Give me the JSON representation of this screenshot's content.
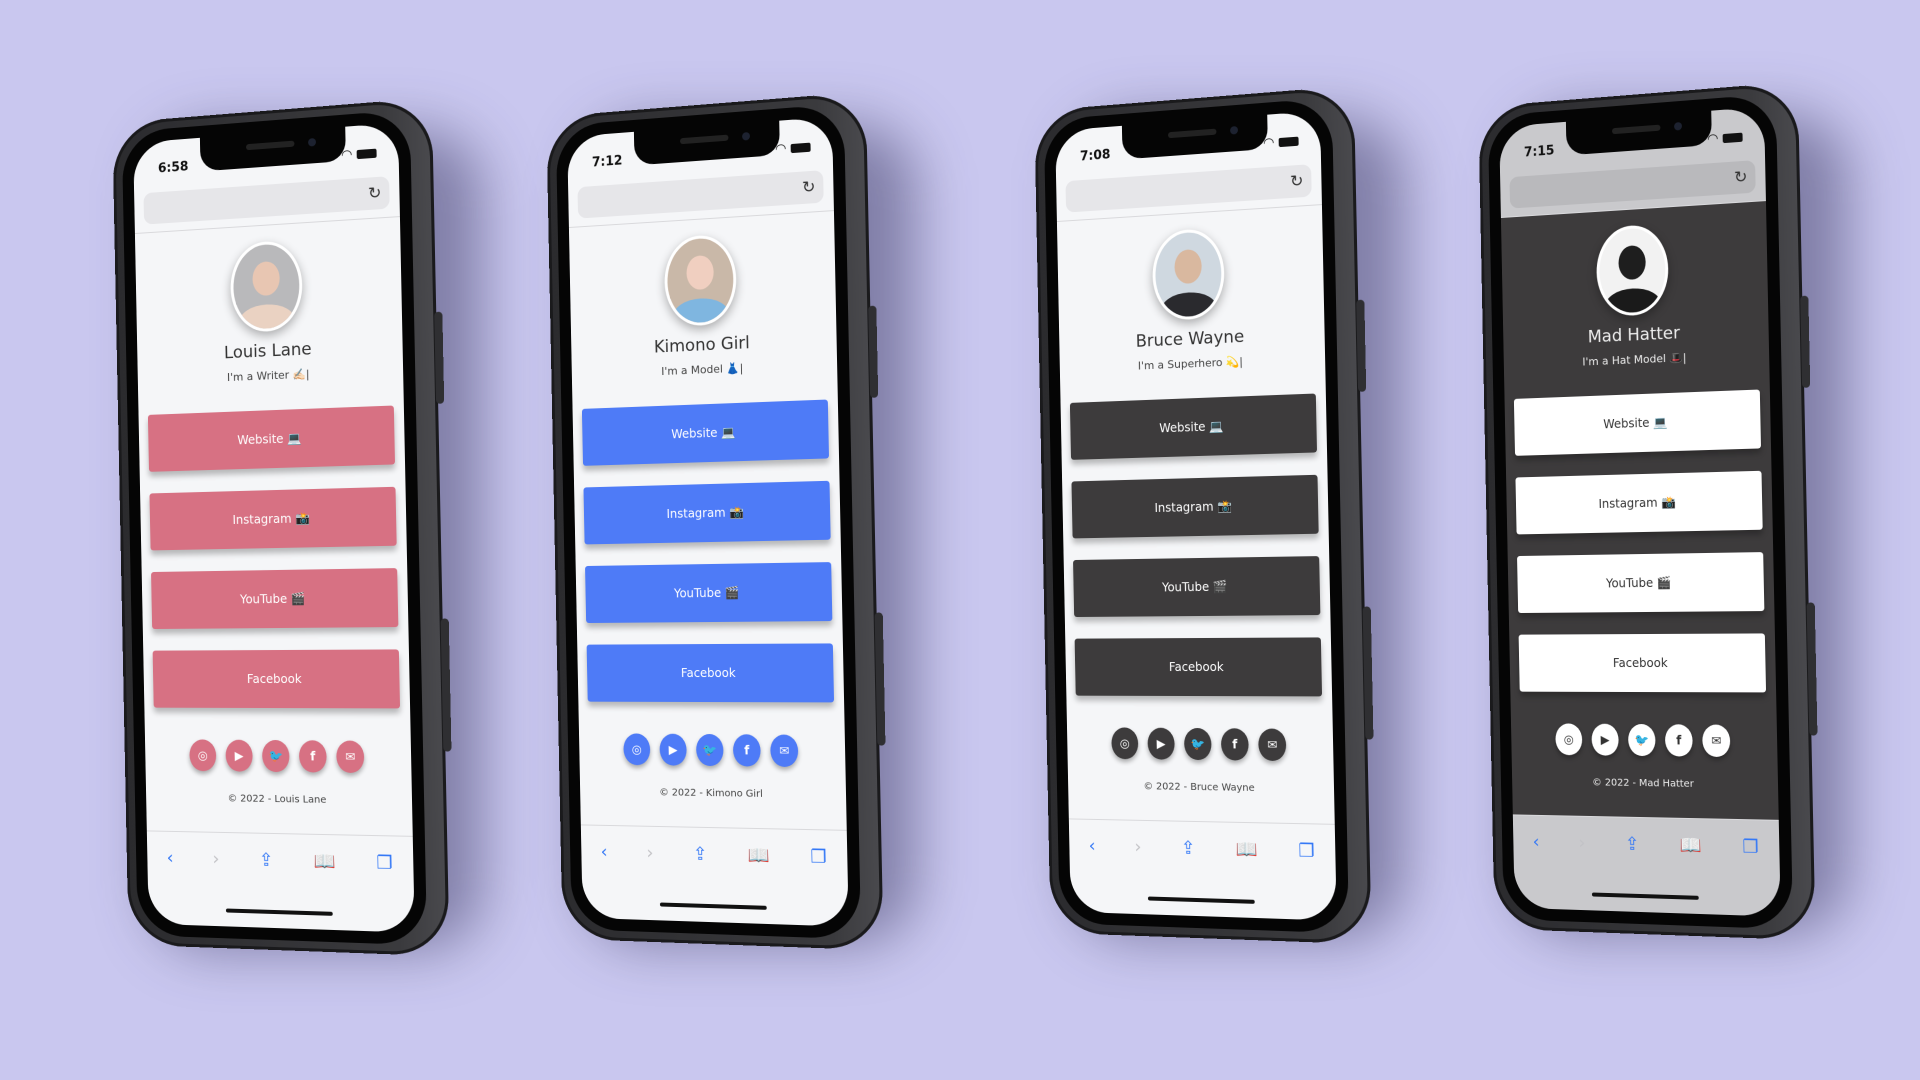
{
  "background_color": "#c9c7ef",
  "phones": [
    {
      "status_time": "6:58",
      "name": "Louis Lane",
      "tagline": "I'm a Writer ✍🏻|",
      "accent": "#d77183",
      "button_text_color": "#ffffff",
      "buttons": [
        "Website 💻",
        "Instagram 📸",
        "YouTube 🎬",
        "Facebook"
      ],
      "socials": [
        "instagram-icon",
        "youtube-icon",
        "twitter-icon",
        "facebook-icon",
        "email-icon"
      ],
      "copyright": "© 2022 - Louis Lane",
      "theme": "light"
    },
    {
      "status_time": "7:12",
      "name": "Kimono Girl",
      "tagline": "I'm a Model 👗|",
      "accent": "#4e7bf7",
      "button_text_color": "#ffffff",
      "buttons": [
        "Website 💻",
        "Instagram 📸",
        "YouTube 🎬",
        "Facebook"
      ],
      "socials": [
        "instagram-icon",
        "youtube-icon",
        "twitter-icon",
        "facebook-icon",
        "email-icon"
      ],
      "copyright": "© 2022 - Kimono Girl",
      "theme": "light"
    },
    {
      "status_time": "7:08",
      "name": "Bruce Wayne",
      "tagline": "I'm a Superhero 💫|",
      "accent": "#3d3b3c",
      "button_text_color": "#ffffff",
      "buttons": [
        "Website 💻",
        "Instagram 📸",
        "YouTube 🎬",
        "Facebook"
      ],
      "socials": [
        "instagram-icon",
        "youtube-icon",
        "twitter-icon",
        "facebook-icon",
        "email-icon"
      ],
      "copyright": "© 2022 - Bruce Wayne",
      "theme": "light"
    },
    {
      "status_time": "7:15",
      "name": "Mad Hatter",
      "tagline": "I'm a Hat Model 🎩|",
      "accent": "#ffffff",
      "button_text_color": "#333333",
      "buttons": [
        "Website 💻",
        "Instagram 📸",
        "YouTube 🎬",
        "Facebook"
      ],
      "socials": [
        "instagram-icon",
        "youtube-icon",
        "twitter-icon",
        "facebook-icon",
        "email-icon"
      ],
      "copyright": "© 2022 - Mad Hatter",
      "theme": "dark"
    }
  ],
  "social_glyphs": {
    "instagram-icon": "◎",
    "youtube-icon": "▶",
    "twitter-icon": "🐦",
    "facebook-icon": "f",
    "email-icon": "✉"
  },
  "toolbar": {
    "back": "‹",
    "forward": "›",
    "share": "⇪",
    "bookmarks": "📖",
    "tabs": "❐",
    "reload": "↻"
  }
}
